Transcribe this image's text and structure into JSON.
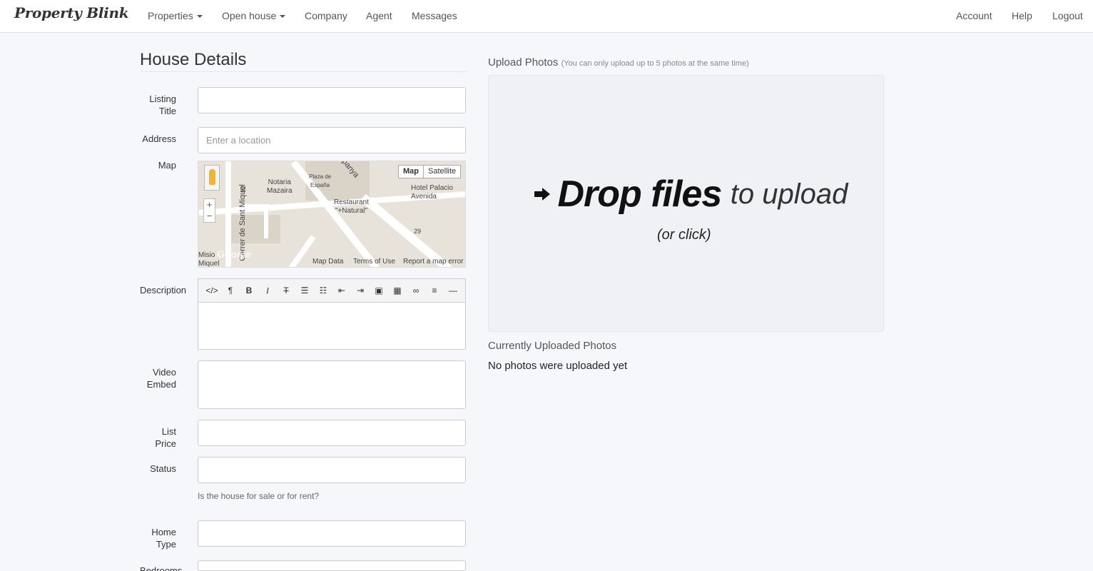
{
  "navbar": {
    "brand": "Property Blink",
    "left_items": [
      {
        "label": "Properties",
        "dropdown": true
      },
      {
        "label": "Open house",
        "dropdown": true
      },
      {
        "label": "Company",
        "dropdown": false
      },
      {
        "label": "Agent",
        "dropdown": false
      },
      {
        "label": "Messages",
        "dropdown": false
      }
    ],
    "right_items": [
      {
        "label": "Account"
      },
      {
        "label": "Help"
      },
      {
        "label": "Logout"
      }
    ]
  },
  "form": {
    "title": "House Details",
    "fields": {
      "listing_title": {
        "label_line1": "Listing",
        "label_line2": "Title",
        "value": ""
      },
      "address": {
        "label": "Address",
        "placeholder": "Enter a location",
        "value": ""
      },
      "map": {
        "label": "Map"
      },
      "description": {
        "label": "Description",
        "value": ""
      },
      "video_embed": {
        "label_line1": "Video",
        "label_line2": "Embed",
        "value": ""
      },
      "list_price": {
        "label": "List Price",
        "value": ""
      },
      "status": {
        "label": "Status",
        "value": "",
        "help": "Is the house for sale or for rent?"
      },
      "home_type": {
        "label_line1": "Home",
        "label_line2": "Type",
        "value": ""
      },
      "bedrooms": {
        "label": "Bedrooms",
        "value": ""
      }
    },
    "editor_toolbar": [
      "html-icon",
      "paragraph-icon",
      "bold-icon",
      "italic-icon",
      "strikethrough-icon",
      "unordered-list-icon",
      "ordered-list-icon",
      "outdent-icon",
      "indent-icon",
      "image-icon",
      "table-icon",
      "link-icon",
      "align-icon",
      "horizontal-rule-icon"
    ]
  },
  "map": {
    "type_buttons": [
      "Map",
      "Satellite"
    ],
    "zoom_in": "+",
    "zoom_out": "−",
    "labels": {
      "notaria": "Notaria\nMazaira",
      "plaza": "Plaza de\nEspaña",
      "hotel": "Hotel Palacio\nAvenida",
      "restaurant": "Restaurant\n\"+Natural\"",
      "street": "Carrer de Sant Miquel",
      "num52": "52",
      "num29": "29",
      "panya": "panya",
      "misio": "Misio\nMiquel",
      "google": "Google"
    },
    "footer": [
      "Map Data",
      "Terms of Use",
      "Report a map error"
    ]
  },
  "upload": {
    "title": "Upload Photos",
    "note": "(You can only upload up to 5 photos at the same time)",
    "drop_bold": "Drop files",
    "drop_light": "to upload",
    "drop_sub": "(or click)",
    "current_title": "Currently Uploaded Photos",
    "no_photos": "No photos were uploaded yet"
  }
}
